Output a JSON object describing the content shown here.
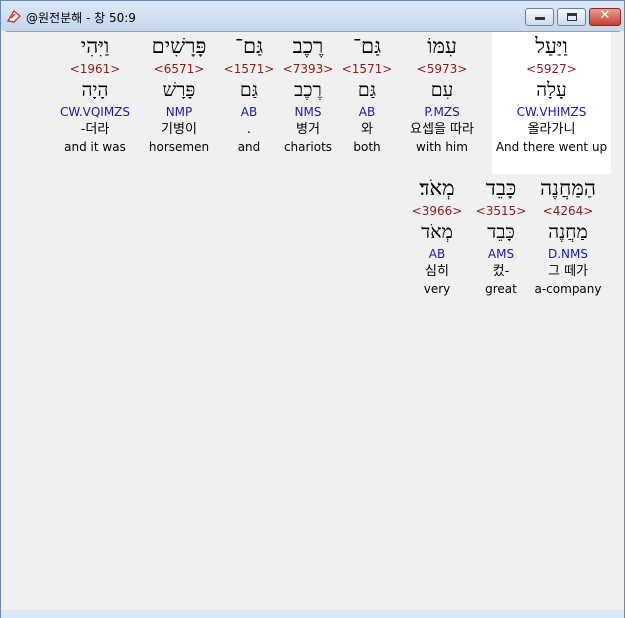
{
  "window": {
    "title": "@원전분해 - 창 50:9",
    "buttons": {
      "minimize": "minimize",
      "maximize": "maximize",
      "close": "✕"
    }
  },
  "colors": {
    "strong": "#8b1a1a",
    "morph": "#1a1aa8",
    "highlight": "#ffffff"
  },
  "row1": [
    {
      "heb": "וַיִּהִי",
      "strong": "<1961>",
      "lemma": "הָיָה",
      "morph": "CW.VQIMZS",
      "kor": "-더라",
      "eng": "and it was"
    },
    {
      "heb": "פָּרָשִׁים",
      "strong": "<6571>",
      "lemma": "פָּרָשׁ",
      "morph": "NMP",
      "kor": "기병이",
      "eng": "horsemen"
    },
    {
      "heb": "גַּם־",
      "strong": "<1571>",
      "lemma": "גַּם",
      "morph": "AB",
      "kor": ".",
      "eng": "and"
    },
    {
      "heb": "רֶכֶב",
      "strong": "<7393>",
      "lemma": "רֶכֶב",
      "morph": "NMS",
      "kor": "병거",
      "eng": "chariots"
    },
    {
      "heb": "גַּם־",
      "strong": "<1571>",
      "lemma": "גַּם",
      "morph": "AB",
      "kor": "와",
      "eng": "both"
    },
    {
      "heb": "עִמּוֹ",
      "strong": "<5973>",
      "lemma": "עִם",
      "morph": "P.MZS",
      "kor": "요셉을 따라",
      "eng": "with him"
    },
    {
      "heb": "וַיַּעַל",
      "strong": "<5927>",
      "lemma": "עָלָה",
      "morph": "CW.VHIMZS",
      "kor": "올라가니",
      "eng": "And there went up"
    }
  ],
  "row2": [
    {
      "heb": "מְאֹד׃",
      "strong": "<3966>",
      "lemma": "מְאֹד",
      "morph": "AB",
      "kor": "심히",
      "eng": "very"
    },
    {
      "heb": "כָּבֵד",
      "strong": "<3515>",
      "lemma": "כָּבֵד",
      "morph": "AMS",
      "kor": "컸-",
      "eng": "great"
    },
    {
      "heb": "הַמַּחֲנֶה",
      "strong": "<4264>",
      "lemma": "מַחֲנֶה",
      "morph": "D.NMS",
      "kor": "그 떼가",
      "eng": "a-company"
    }
  ]
}
